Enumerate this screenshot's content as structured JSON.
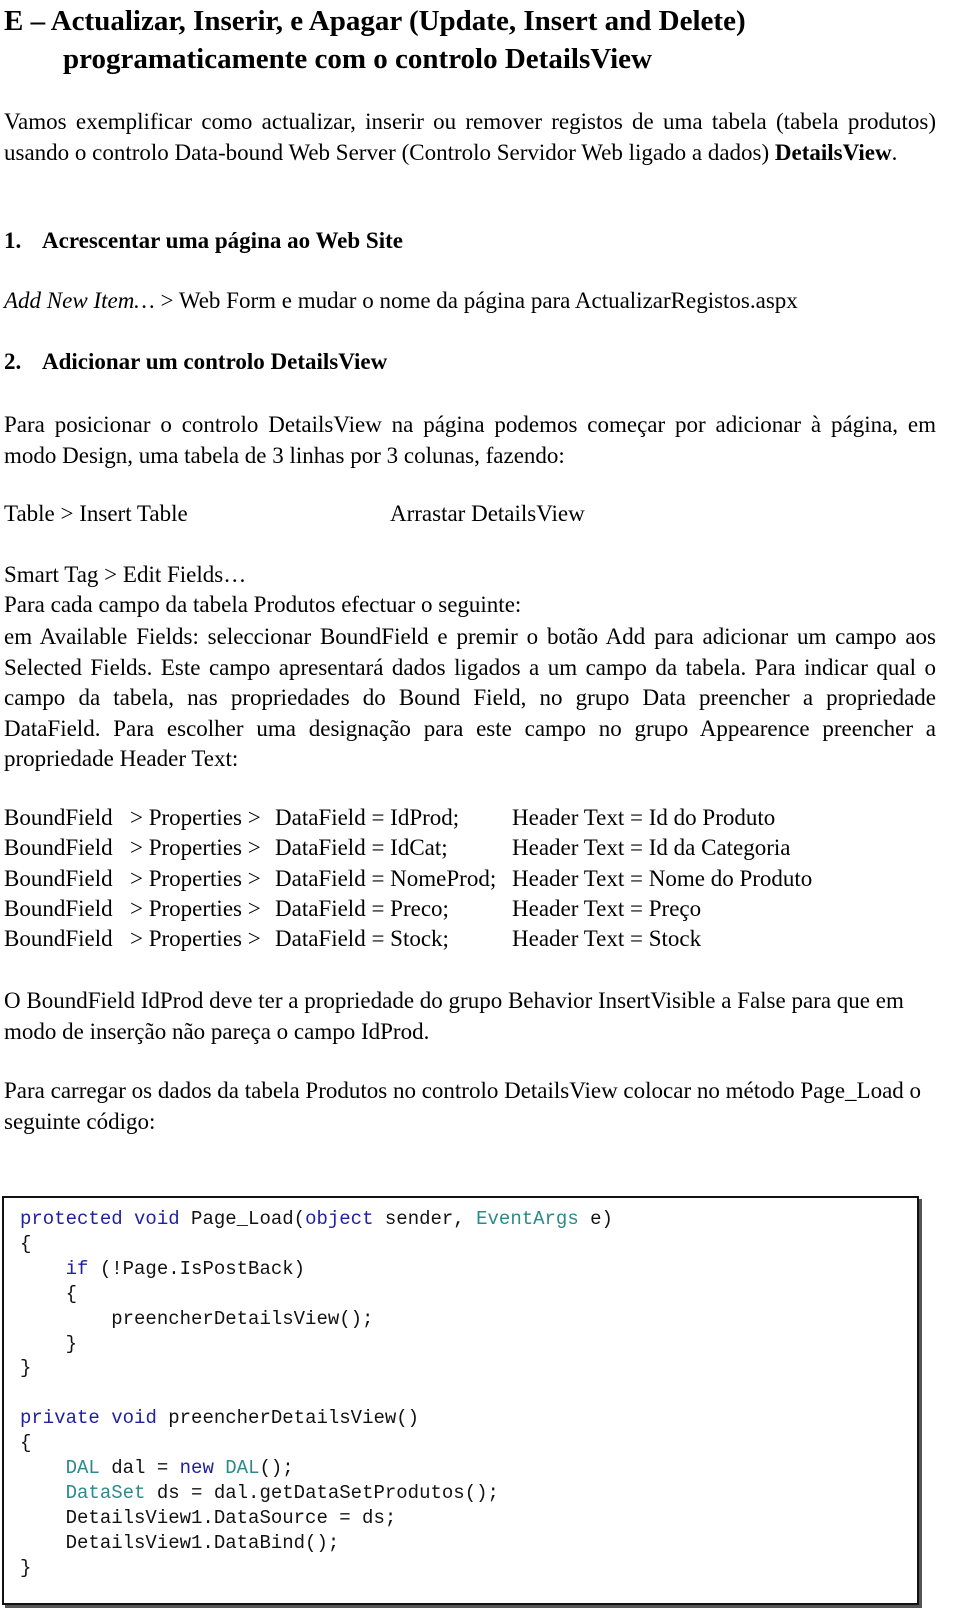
{
  "title": {
    "line1": "E – Actualizar, Inserir, e Apagar (Update, Insert and Delete)",
    "line2": "programaticamente com o controlo DetailsView"
  },
  "intro": {
    "text": "Vamos exemplificar como actualizar, inserir ou remover registos de uma tabela (tabela produtos) usando o controlo Data-bound Web Server (Controlo Servidor Web ligado a dados) ",
    "bold": "DetailsView",
    "end": "."
  },
  "section1": {
    "number": "1.",
    "heading": "Acrescentar uma página ao Web Site",
    "step_italic": "Add New Item…",
    "step_rest": " >  Web Form  e mudar o nome da página para ActualizarRegistos.aspx"
  },
  "section2": {
    "number": "2.",
    "heading": "Adicionar um controlo DetailsView",
    "paragraph": "Para posicionar o controlo DetailsView na página podemos começar por adicionar à página, em modo Design, uma tabela de 3 linhas por 3 colunas, fazendo:",
    "step_left": "Table  >  Insert Table",
    "step_right": "Arrastar DetailsView",
    "smart_tag": "Smart Tag  >  Edit Fields…",
    "fields_intro": "Para cada campo da tabela Produtos efectuar o seguinte:",
    "fields_paragraph": "em Available Fields: seleccionar BoundField e premir o botão Add para adicionar um campo aos Selected Fields. Este campo apresentará dados ligados a um campo da tabela. Para indicar qual o campo da tabela, nas propriedades do Bound Field, no grupo Data preencher a propriedade DataField. Para escolher uma designação para este campo no grupo Appearence preencher a propriedade Header Text:"
  },
  "bound_fields": [
    {
      "a": "BoundField",
      "b": "> Properties  >",
      "c": "DataField = IdProd;",
      "d": "Header Text = Id do Produto"
    },
    {
      "a": "BoundField",
      "b": "> Properties  >",
      "c": "DataField = IdCat;",
      "d": "Header Text = Id da Categoria"
    },
    {
      "a": "BoundField",
      "b": "> Properties  >",
      "c": "DataField = NomeProd;",
      "d": "Header Text = Nome do Produto"
    },
    {
      "a": "BoundField",
      "b": "> Properties  >",
      "c": "DataField = Preco;",
      "d": "Header Text = Preço"
    },
    {
      "a": "BoundField",
      "b": "> Properties  >",
      "c": "DataField = Stock;",
      "d": "Header Text = Stock"
    }
  ],
  "insert_visible_note": "O BoundField IdProd deve ter a propriedade do grupo Behavior InsertVisible a False para que em modo de inserção não pareça o campo IdProd.",
  "page_load_note": "Para carregar os dados da tabela Produtos no controlo DetailsView colocar no método Page_Load o seguinte código:",
  "code": {
    "lines": [
      {
        "parts": [
          {
            "t": "protected",
            "k": "kw"
          },
          {
            "t": " "
          },
          {
            "t": "void",
            "k": "kw"
          },
          {
            "t": " Page_Load("
          },
          {
            "t": "object",
            "k": "kw"
          },
          {
            "t": " sender, "
          },
          {
            "t": "EventArgs",
            "k": "ty"
          },
          {
            "t": " e)"
          }
        ]
      },
      {
        "parts": [
          {
            "t": "{"
          }
        ]
      },
      {
        "parts": [
          {
            "t": "    "
          },
          {
            "t": "if",
            "k": "kw"
          },
          {
            "t": " (!Page.IsPostBack)"
          }
        ]
      },
      {
        "parts": [
          {
            "t": "    {"
          }
        ]
      },
      {
        "parts": [
          {
            "t": "        preencherDetailsView();"
          }
        ]
      },
      {
        "parts": [
          {
            "t": "    }"
          }
        ]
      },
      {
        "parts": [
          {
            "t": "}"
          }
        ]
      },
      {
        "parts": [
          {
            "t": ""
          }
        ]
      },
      {
        "parts": [
          {
            "t": "private",
            "k": "kw"
          },
          {
            "t": " "
          },
          {
            "t": "void",
            "k": "kw"
          },
          {
            "t": " preencherDetailsView()"
          }
        ]
      },
      {
        "parts": [
          {
            "t": "{"
          }
        ]
      },
      {
        "parts": [
          {
            "t": "    "
          },
          {
            "t": "DAL",
            "k": "ty"
          },
          {
            "t": " dal = "
          },
          {
            "t": "new",
            "k": "kw"
          },
          {
            "t": " "
          },
          {
            "t": "DAL",
            "k": "ty"
          },
          {
            "t": "();"
          }
        ]
      },
      {
        "parts": [
          {
            "t": "    "
          },
          {
            "t": "DataSet",
            "k": "ty"
          },
          {
            "t": " ds = dal.getDataSetProdutos();"
          }
        ]
      },
      {
        "parts": [
          {
            "t": "    DetailsView1.DataSource = ds;"
          }
        ]
      },
      {
        "parts": [
          {
            "t": "    DetailsView1.DataBind();"
          }
        ]
      },
      {
        "parts": [
          {
            "t": "}"
          }
        ]
      }
    ]
  }
}
